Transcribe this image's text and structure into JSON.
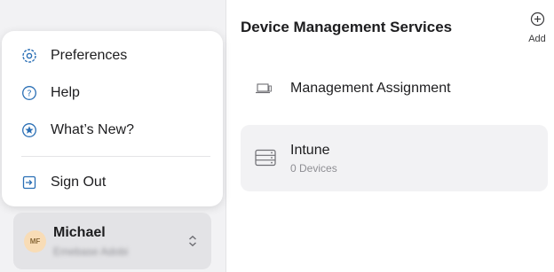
{
  "menu": {
    "items": [
      {
        "label": "Preferences",
        "icon": "gear-icon"
      },
      {
        "label": "Help",
        "icon": "question-icon"
      },
      {
        "label": "What’s New?",
        "icon": "star-icon"
      },
      {
        "label": "Sign Out",
        "icon": "sign-out-icon"
      }
    ]
  },
  "user": {
    "initials": "MF",
    "name": "Michael",
    "subtitle": "Emebase Adobi"
  },
  "main": {
    "title": "Device Management Services",
    "add_label": "Add",
    "rows": [
      {
        "title": "Management Assignment",
        "subtitle": "",
        "icon": "laptop-icon"
      },
      {
        "title": "Intune",
        "subtitle": "0 Devices",
        "icon": "server-icon"
      }
    ]
  },
  "colors": {
    "accent": "#2a6fb5",
    "sidebar_bg": "#f2f2f4",
    "selected_row": "#f2f2f4"
  }
}
